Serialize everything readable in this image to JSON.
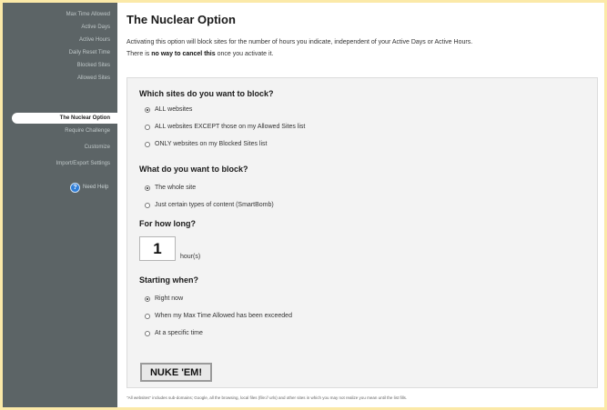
{
  "sidebar": {
    "items": [
      {
        "label": "Max Time Allowed"
      },
      {
        "label": "Active Days"
      },
      {
        "label": "Active Hours"
      },
      {
        "label": "Daily Reset Time"
      },
      {
        "label": "Blocked Sites"
      },
      {
        "label": "Allowed Sites"
      },
      {
        "label": "The Nuclear Option"
      },
      {
        "label": "Require Challenge"
      },
      {
        "label": "Customize"
      },
      {
        "label": "Import/Export Settings"
      }
    ],
    "help_label": "Need Help"
  },
  "main": {
    "title": "The Nuclear Option",
    "intro_text": "Activating this option will block sites for the number of hours you indicate, independent of your Active Days or Active Hours.",
    "intro_prefix": "There is ",
    "intro_bold": "no way to cancel this",
    "intro_suffix": " once you activate it.",
    "sections": {
      "which_sites": {
        "question": "Which sites do you want to block?",
        "options": [
          "ALL websites",
          "ALL websites EXCEPT those on my Allowed Sites list",
          "ONLY websites on my Blocked Sites list"
        ]
      },
      "what_block": {
        "question": "What do you want to block?",
        "options": [
          "The whole site",
          "Just certain types of content (SmartBomb)"
        ]
      },
      "how_long": {
        "question": "For how long?",
        "value": "1",
        "unit": "hour(s)"
      },
      "starting": {
        "question": "Starting when?",
        "options": [
          "Right now",
          "When my Max Time Allowed has been exceeded",
          "At a specific time"
        ]
      }
    },
    "nuke_button": "NUKE 'EM!",
    "footnote": "\"All websites\" includes sub-domains; Google, all the browsing, local files (file:// urls) and other sites in which you may not realize you mean until the list fills."
  },
  "colors": {
    "border": "#fbe9a8",
    "sidebar": "#5c6466",
    "panel": "#f3f3f3"
  }
}
